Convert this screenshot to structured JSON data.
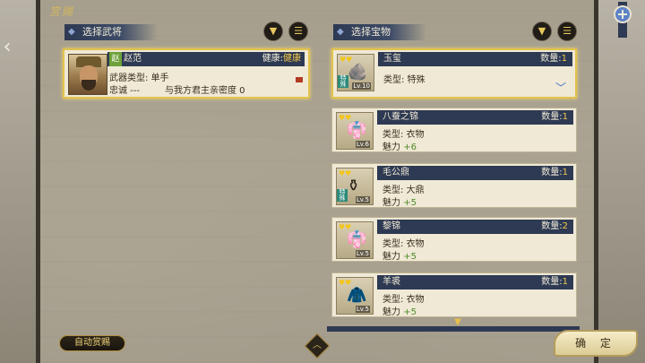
{
  "panel_title": "赏赐",
  "left_section": {
    "title": "选择武将"
  },
  "right_section": {
    "title": "选择宝物"
  },
  "filter_icon": "filter-funnel-icon",
  "list_icon": "list-menu-icon",
  "general": {
    "tag": "赵",
    "name": "赵范",
    "health_label": "健康:",
    "health_value": "健康",
    "weapon_line": "武器类型: 单手",
    "loyalty_line": "忠诚 ---",
    "intimacy_line": "与我方君主亲密度 0"
  },
  "items": [
    {
      "name": "玉玺",
      "qty_label": "数量:",
      "qty": "1",
      "type_line": "类型: 特殊",
      "level": "Lv.10",
      "special": "特殊",
      "selected": true,
      "glyph": "🪨"
    },
    {
      "name": "八蚕之锦",
      "qty_label": "数量:",
      "qty": "1",
      "type_line": "类型: 衣物",
      "charm_label": "魅力",
      "charm": "+6",
      "level": "Lv.6",
      "glyph": "👘"
    },
    {
      "name": "毛公鼎",
      "qty_label": "数量:",
      "qty": "1",
      "type_line": "类型: 大鼎",
      "charm_label": "魅力",
      "charm": "+5",
      "level": "Lv.5",
      "special": "特殊",
      "glyph": "⚱"
    },
    {
      "name": "黎锦",
      "qty_label": "数量:",
      "qty": "2",
      "type_line": "类型: 衣物",
      "charm_label": "魅力",
      "charm": "+5",
      "level": "Lv.5",
      "glyph": "👘"
    },
    {
      "name": "羊裘",
      "qty_label": "数量:",
      "qty": "1",
      "type_line": "类型: 衣物",
      "charm_label": "魅力",
      "charm": "+5",
      "level": "Lv.5",
      "glyph": "🧥"
    }
  ],
  "buttons": {
    "auto_reward": "自动赏赐",
    "confirm": "确 定"
  }
}
